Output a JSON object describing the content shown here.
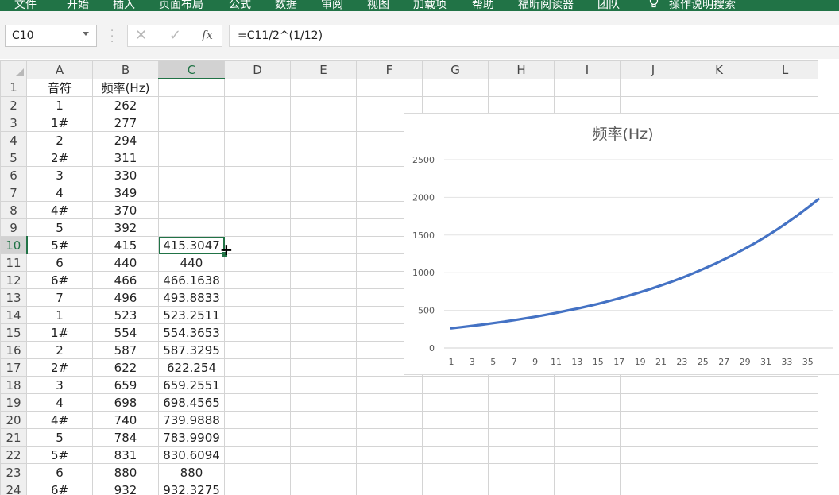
{
  "ribbon": {
    "tabs": [
      "文件",
      "开始",
      "插入",
      "页面布局",
      "公式",
      "数据",
      "审阅",
      "视图",
      "加载项",
      "帮助",
      "福昕阅读器",
      "团队",
      "操作说明搜索"
    ],
    "color": "#217346"
  },
  "formula_bar": {
    "name_box": "C10",
    "cancel_icon": "✕",
    "enter_icon": "✓",
    "fx_label": "fx",
    "formula": "=C11/2^(1/12)"
  },
  "sheet": {
    "columns": [
      "A",
      "B",
      "C",
      "D",
      "E",
      "F",
      "G",
      "H",
      "I",
      "J",
      "K",
      "L"
    ],
    "selected_column": "C",
    "active_row": "10",
    "rows": [
      {
        "n": "1",
        "a": "音符",
        "b": "频率(Hz)",
        "c": ""
      },
      {
        "n": "2",
        "a": "1",
        "b": "262",
        "c": ""
      },
      {
        "n": "3",
        "a": "1#",
        "b": "277",
        "c": ""
      },
      {
        "n": "4",
        "a": "2",
        "b": "294",
        "c": ""
      },
      {
        "n": "5",
        "a": "2#",
        "b": "311",
        "c": ""
      },
      {
        "n": "6",
        "a": "3",
        "b": "330",
        "c": ""
      },
      {
        "n": "7",
        "a": "4",
        "b": "349",
        "c": ""
      },
      {
        "n": "8",
        "a": "4#",
        "b": "370",
        "c": ""
      },
      {
        "n": "9",
        "a": "5",
        "b": "392",
        "c": ""
      },
      {
        "n": "10",
        "a": "5#",
        "b": "415",
        "c": "415.3047"
      },
      {
        "n": "11",
        "a": "6",
        "b": "440",
        "c": "440"
      },
      {
        "n": "12",
        "a": "6#",
        "b": "466",
        "c": "466.1638"
      },
      {
        "n": "13",
        "a": "7",
        "b": "496",
        "c": "493.8833"
      },
      {
        "n": "14",
        "a": "1",
        "b": "523",
        "c": "523.2511"
      },
      {
        "n": "15",
        "a": "1#",
        "b": "554",
        "c": "554.3653"
      },
      {
        "n": "16",
        "a": "2",
        "b": "587",
        "c": "587.3295"
      },
      {
        "n": "17",
        "a": "2#",
        "b": "622",
        "c": "622.254"
      },
      {
        "n": "18",
        "a": "3",
        "b": "659",
        "c": "659.2551"
      },
      {
        "n": "19",
        "a": "4",
        "b": "698",
        "c": "698.4565"
      },
      {
        "n": "20",
        "a": "4#",
        "b": "740",
        "c": "739.9888"
      },
      {
        "n": "21",
        "a": "5",
        "b": "784",
        "c": "783.9909"
      },
      {
        "n": "22",
        "a": "5#",
        "b": "831",
        "c": "830.6094"
      },
      {
        "n": "23",
        "a": "6",
        "b": "880",
        "c": "880"
      },
      {
        "n": "24",
        "a": "6#",
        "b": "932",
        "c": "932.3275"
      }
    ]
  },
  "chart_data": {
    "type": "line",
    "title": "频率(Hz)",
    "xlabel": "",
    "ylabel": "",
    "ylim": [
      0,
      2500
    ],
    "yticks": [
      "0",
      "500",
      "1000",
      "1500",
      "2000",
      "2500"
    ],
    "xticks": [
      "1",
      "3",
      "5",
      "7",
      "9",
      "11",
      "13",
      "15",
      "17",
      "19",
      "21",
      "23",
      "25",
      "27",
      "29",
      "31",
      "33",
      "35"
    ],
    "grid": true,
    "series_color": "#4472c4",
    "series": [
      {
        "values": [
          262,
          277,
          294,
          311,
          330,
          349,
          370,
          392,
          415,
          440,
          466,
          496,
          523,
          554,
          587,
          622,
          659,
          698,
          740,
          784,
          831,
          880,
          932,
          988,
          1047,
          1109,
          1175,
          1245,
          1319,
          1397,
          1480,
          1568,
          1661,
          1760,
          1865,
          1976
        ]
      }
    ]
  }
}
